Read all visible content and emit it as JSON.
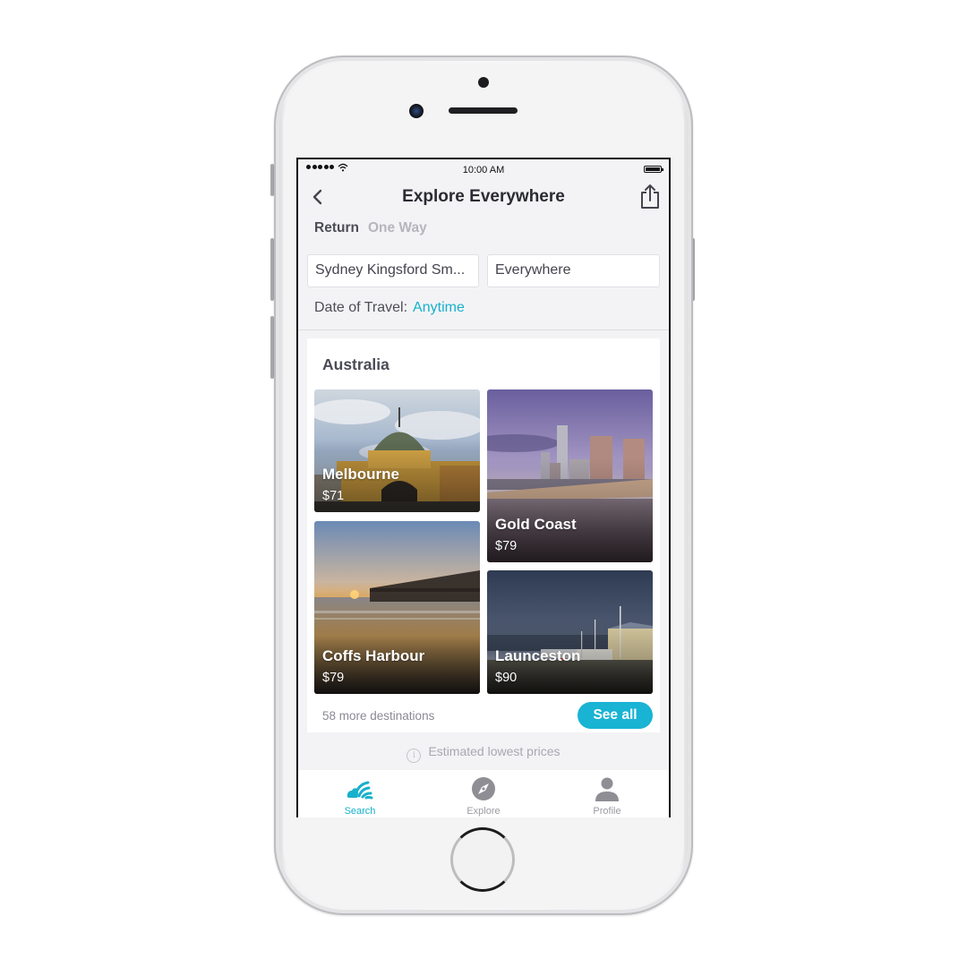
{
  "status_bar": {
    "time": "10:00 AM",
    "signal_bars": 5,
    "icons": [
      "signal-icon",
      "wifi-icon",
      "battery-icon"
    ]
  },
  "nav": {
    "title": "Explore Everywhere",
    "back_icon": "chevron-left-icon",
    "share_icon": "share-icon"
  },
  "trip_type": {
    "options": [
      "Return",
      "One Way"
    ],
    "selected": "Return"
  },
  "search": {
    "from_value": "Sydney Kingsford Sm...",
    "to_value": "Everywhere",
    "date_label": "Date of Travel:",
    "date_value": "Anytime"
  },
  "section": {
    "title": "Australia",
    "destinations": [
      {
        "name": "Melbourne",
        "price": "$71"
      },
      {
        "name": "Gold Coast",
        "price": "$79"
      },
      {
        "name": "Coffs Harbour",
        "price": "$79"
      },
      {
        "name": "Launceston",
        "price": "$90"
      }
    ],
    "more_text": "58 more destinations",
    "see_all_label": "See all"
  },
  "footer_note": {
    "icon": "info-icon",
    "text": "Estimated lowest prices"
  },
  "tabbar": {
    "items": [
      {
        "label": "Search",
        "icon": "skyscanner-search-icon",
        "active": true
      },
      {
        "label": "Explore",
        "icon": "compass-icon",
        "active": false
      },
      {
        "label": "Profile",
        "icon": "person-icon",
        "active": false
      }
    ]
  },
  "colors": {
    "accent": "#17b0cc",
    "button": "#19b3d4",
    "inactive_tab": "#9b9ba3",
    "title_text": "#2b2b33"
  }
}
